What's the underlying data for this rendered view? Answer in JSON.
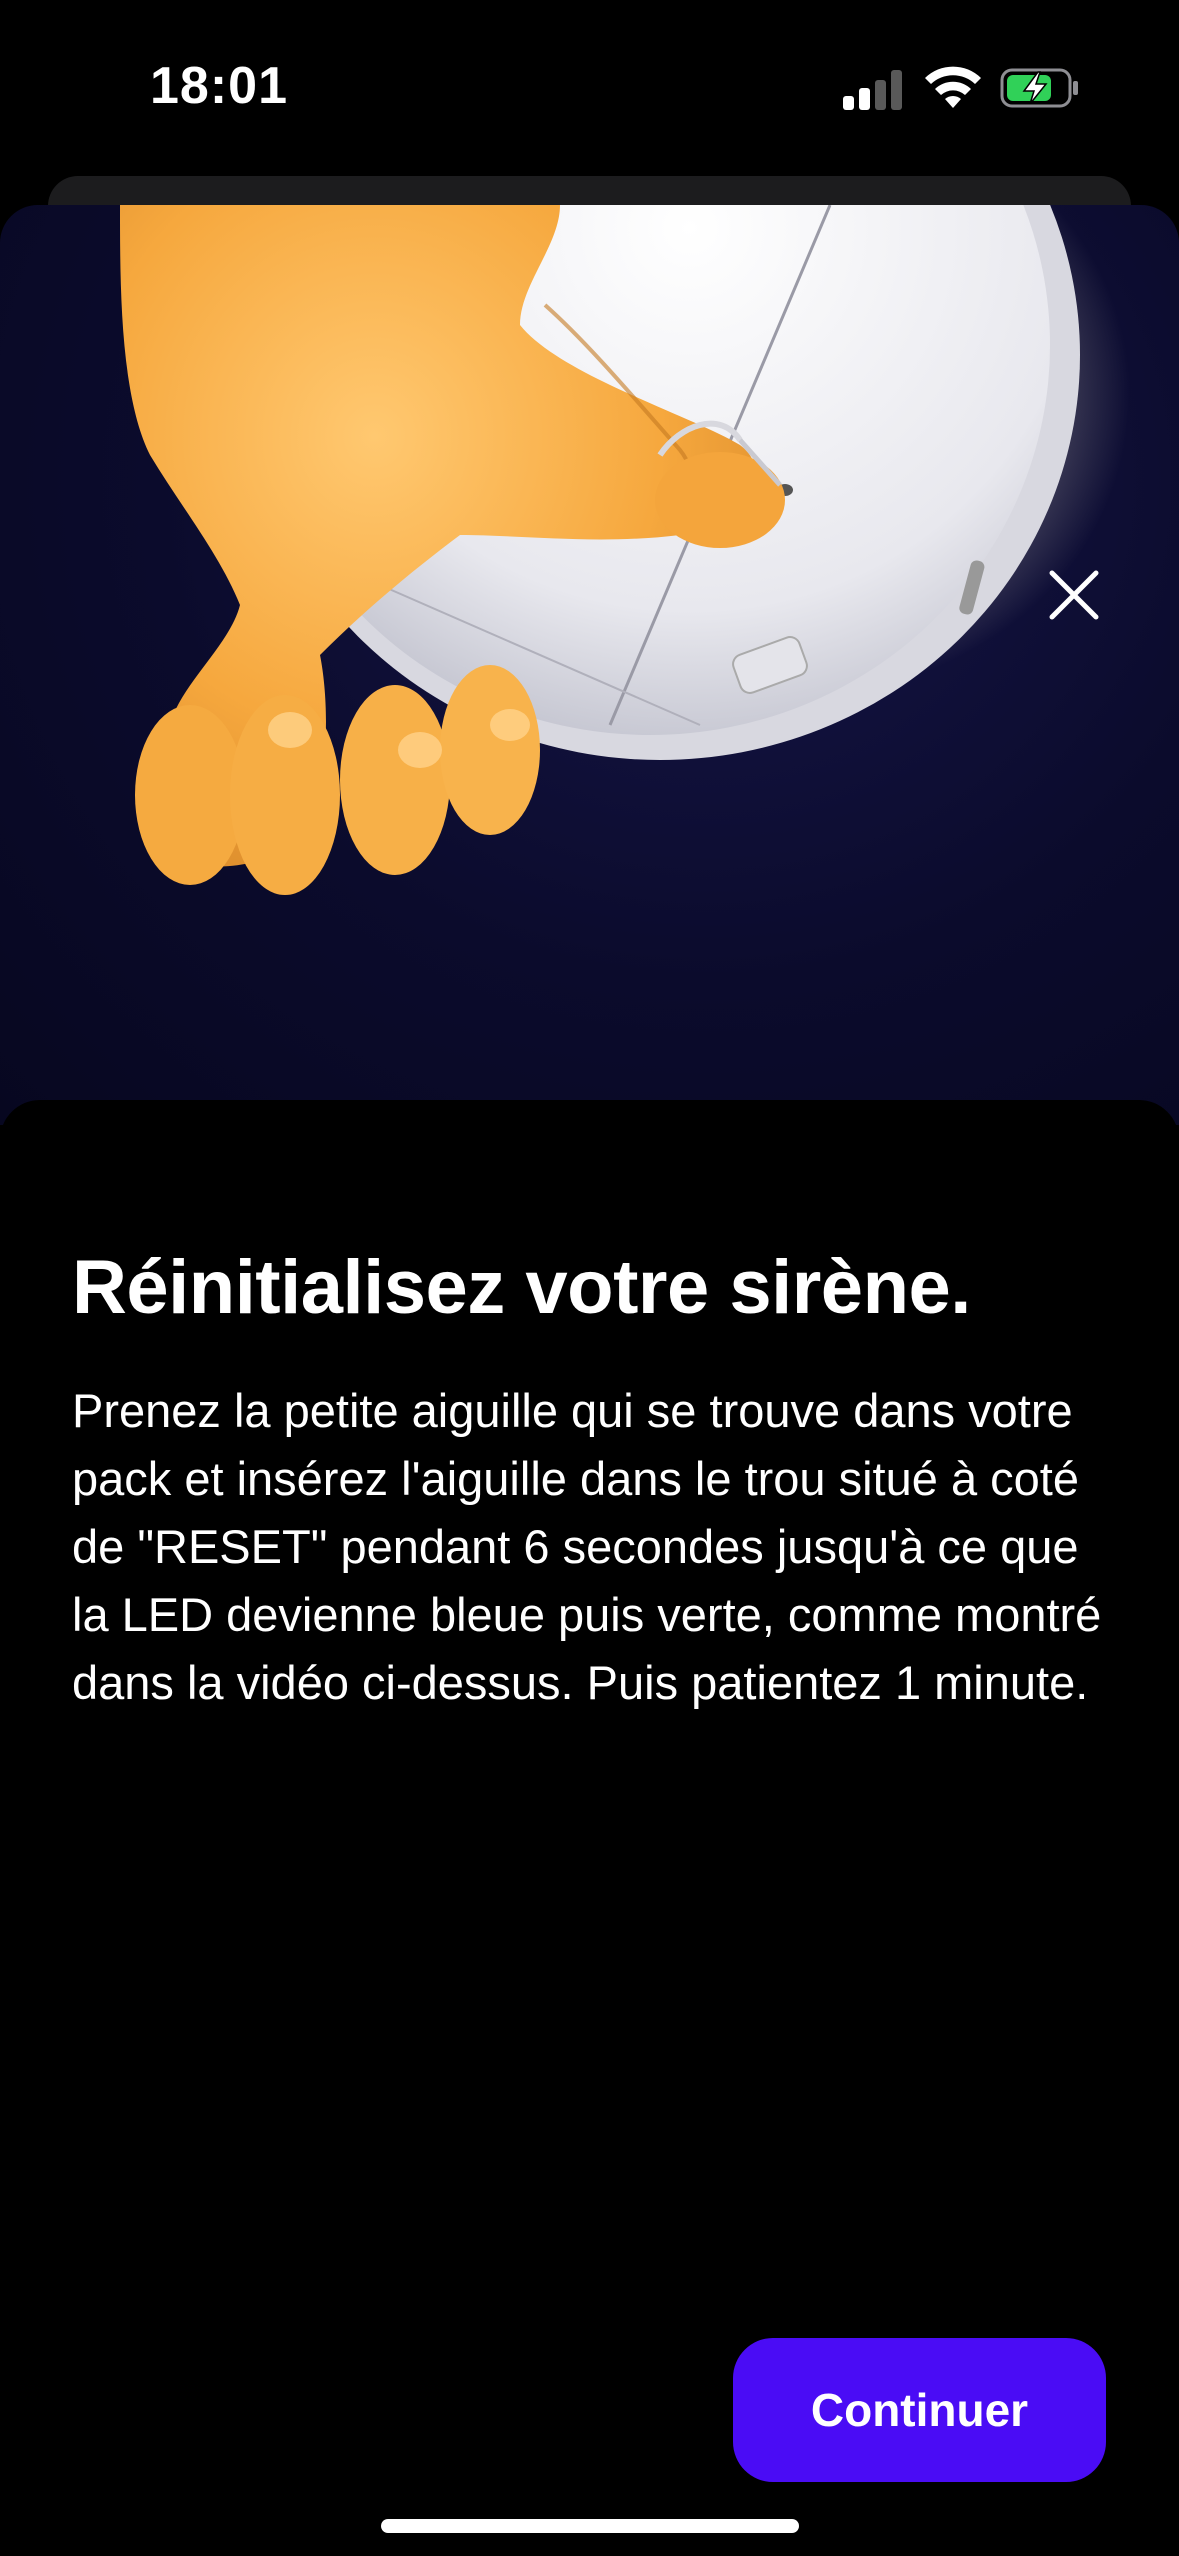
{
  "status_bar": {
    "time": "18:01",
    "signal_icon": "cellular-signal-icon",
    "wifi_icon": "wifi-icon",
    "battery_icon": "battery-charging-icon",
    "battery_color": "#30d158"
  },
  "hero": {
    "illustration": "hand-inserting-pin-into-siren-illustration",
    "background_color": "#0b0b2c"
  },
  "close_icon": "close-icon",
  "title": "Réinitialisez votre sirène.",
  "description": "Prenez la petite aiguille qui se trouve dans votre pack et insérez l'aiguille dans le trou situé à coté de \"RESET\" pendant 6 secondes jusqu'à ce que la LED devienne bleue puis verte, comme montré dans la vidéo ci-dessus. Puis patientez 1 minute.",
  "continue_button": {
    "label": "Continuer",
    "color": "#4a0cf5"
  }
}
